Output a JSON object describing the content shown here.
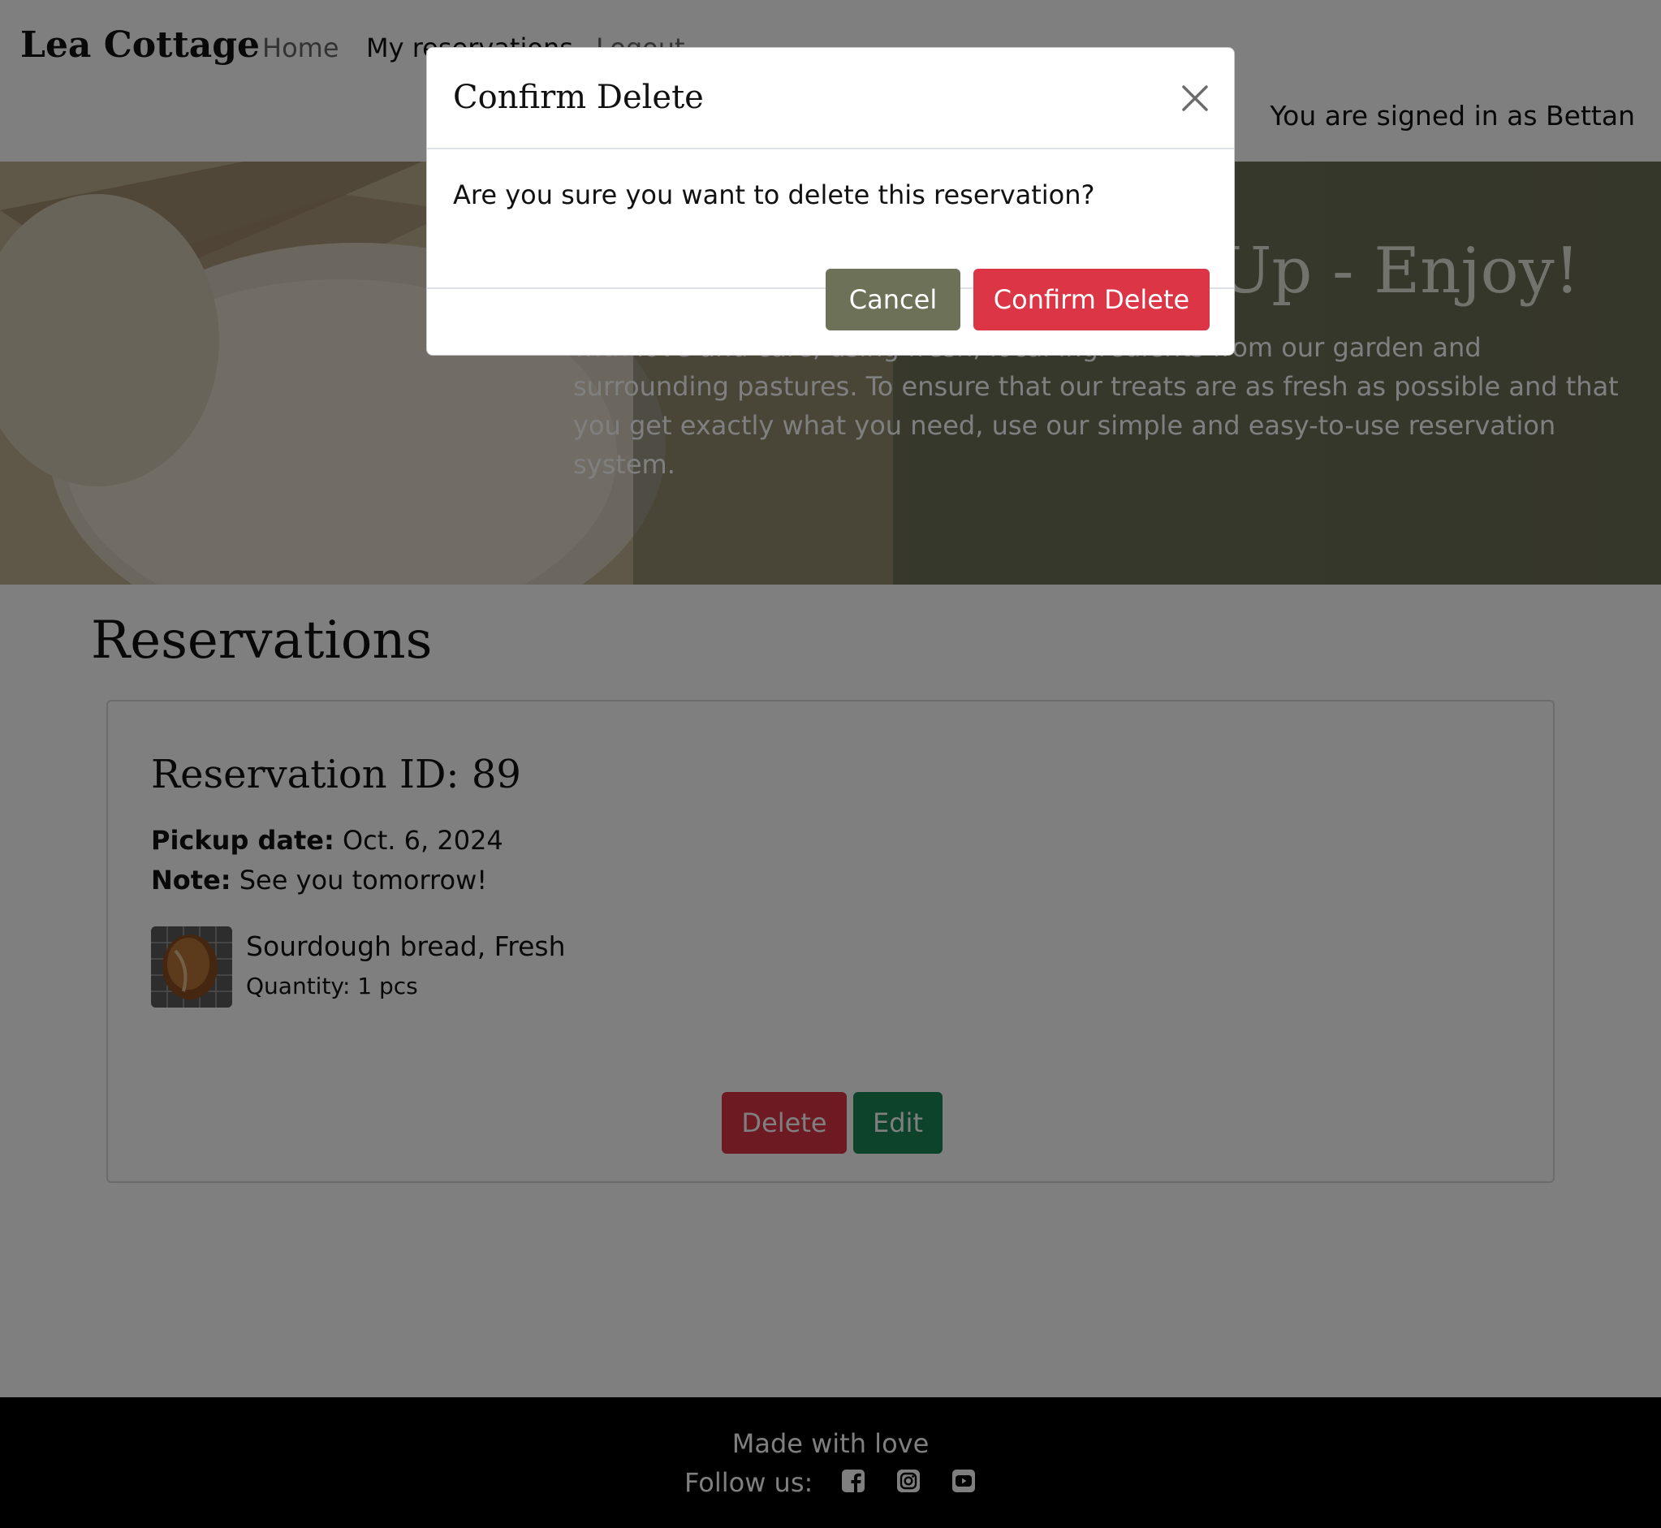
{
  "navbar": {
    "brand": "Lea Cottage",
    "links": [
      "Home",
      "My reservations",
      "Logout"
    ],
    "signed_in": "You are signed in as Bettan"
  },
  "hero": {
    "title": "Up - Enjoy!",
    "text": "with love and care, using fresh, local ingredients from our garden and surrounding pastures. To ensure that our treats are as fresh as possible and that you get exactly what you need, use our simple and easy-to-use reservation system."
  },
  "main": {
    "title": "Reservations",
    "reservation": {
      "id_label": "Reservation ID: 89",
      "pickup_label": "Pickup date:",
      "pickup_value": "Oct. 6, 2024",
      "note_label": "Note:",
      "note_value": "See you tomorrow!",
      "product_name": "Sourdough bread, Fresh",
      "product_qty": "Quantity: 1 pcs",
      "delete_label": "Delete",
      "edit_label": "Edit"
    }
  },
  "footer": {
    "made": "Made with love",
    "follow": "Follow us:",
    "icons": [
      "facebook-icon",
      "instagram-icon",
      "youtube-icon"
    ]
  },
  "modal": {
    "title": "Confirm Delete",
    "message": "Are you sure you want to delete this reservation?",
    "cancel_label": "Cancel",
    "confirm_label": "Confirm Delete"
  },
  "colors": {
    "danger": "#dc3545",
    "success": "#198754",
    "secondary": "#6c7158",
    "footer_bg": "#000000"
  }
}
